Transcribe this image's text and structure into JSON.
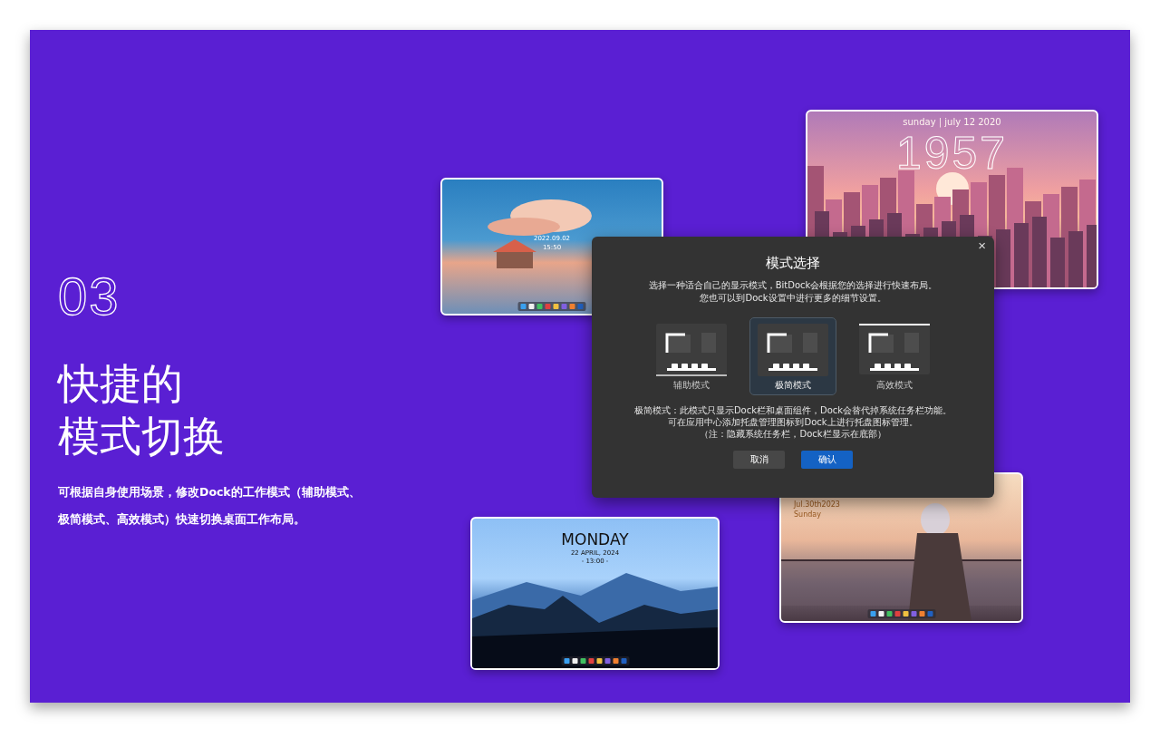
{
  "section": {
    "number": "03",
    "heading_lines": [
      "快捷的",
      "模式切换"
    ],
    "description": "可根据自身使用场景，修改Dock的工作模式（辅助模式、极简模式、高效模式）快速切换桌面工作布局。"
  },
  "desktops": [
    {
      "kind": "sea",
      "texts": [
        {
          "kind": "date",
          "text": "2022.09.02"
        },
        {
          "kind": "time",
          "text": "15:50"
        }
      ]
    },
    {
      "kind": "city",
      "texts": [
        {
          "kind": "date",
          "text": "sunday | july 12 2020"
        },
        {
          "kind": "big",
          "text": "1957"
        }
      ]
    },
    {
      "kind": "forest",
      "texts": [
        {
          "kind": "day",
          "text": "MONDAY"
        },
        {
          "kind": "date",
          "text": "22  APRIL, 2024"
        },
        {
          "kind": "date",
          "text": "- 13:00 -"
        }
      ]
    },
    {
      "kind": "anime",
      "texts": [
        {
          "kind": "date",
          "text": "Jul.30th2023"
        },
        {
          "kind": "date",
          "text": "Sunday"
        }
      ]
    }
  ],
  "dialog": {
    "title": "模式选择",
    "close": "×",
    "subtitle_lines": [
      "选择一种适合自己的显示模式，BitDock会根据您的选择进行快速布局。",
      "您也可以到Dock设置中进行更多的细节设置。"
    ],
    "modes": [
      {
        "kind": "assist",
        "label": "辅助模式",
        "selected": false
      },
      {
        "kind": "minimal",
        "label": "极简模式",
        "selected": true
      },
      {
        "kind": "efficient",
        "label": "高效模式",
        "selected": false
      }
    ],
    "description_lines": [
      "极简模式：此模式只显示Dock栏和桌面组件，Dock会替代掉系统任务栏功能。",
      "可在应用中心添加托盘管理图标到Dock上进行托盘图标管理。",
      "（注：隐藏系统任务栏，Dock栏显示在底部）"
    ],
    "buttons": [
      {
        "kind": "secondary",
        "label": "取消"
      },
      {
        "kind": "primary",
        "label": "确认"
      }
    ]
  }
}
